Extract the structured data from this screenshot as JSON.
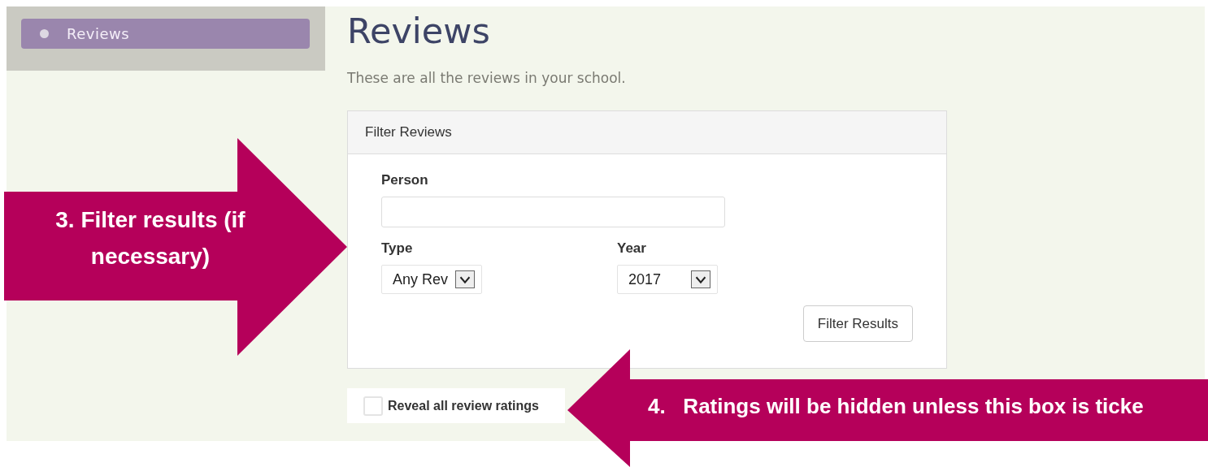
{
  "sidebar": {
    "items": [
      {
        "label": "Reviews",
        "selected": true
      }
    ]
  },
  "page": {
    "title": "Reviews",
    "intro": "These are all the reviews in your school."
  },
  "filter_panel": {
    "title": "Filter Reviews",
    "fields": [
      {
        "kind": "text",
        "label": "Person"
      },
      {
        "kind": "select",
        "label": "Type",
        "value": "Any Rev"
      },
      {
        "kind": "select",
        "label": "Year",
        "value": "2017"
      }
    ],
    "button": "Filter Results"
  },
  "reveal_ratings": {
    "label": "Reveal all review ratings",
    "checked": false
  },
  "callouts": [
    {
      "kind": "right",
      "text": "3. Filter results (if necessary)"
    },
    {
      "kind": "left",
      "text": "4.   Ratings will be hidden unless this box is ticke"
    }
  ]
}
